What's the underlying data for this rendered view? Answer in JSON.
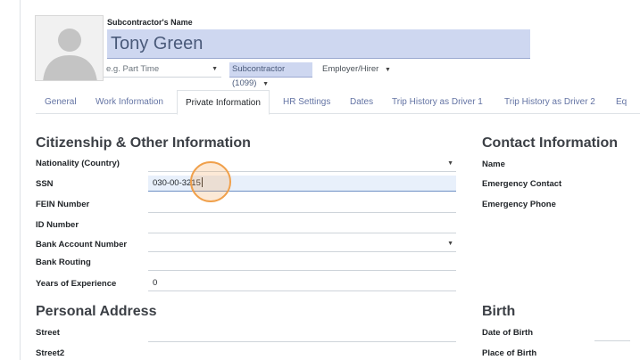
{
  "header": {
    "name_caption": "Subcontractor's Name",
    "name_value": "Tony Green",
    "time_type_placeholder": "e.g. Part Time",
    "subcontractor_type": "Subcontractor (1099)",
    "employer_type": "Employer/Hirer"
  },
  "tabs": [
    {
      "label": "General"
    },
    {
      "label": "Work Information"
    },
    {
      "label": "Private Information",
      "active": true
    },
    {
      "label": "HR Settings"
    },
    {
      "label": "Dates"
    },
    {
      "label": "Trip History as Driver 1"
    },
    {
      "label": "Trip History as Driver 2"
    },
    {
      "label": "Eq"
    }
  ],
  "citizenship": {
    "title": "Citizenship & Other Information",
    "rows": [
      {
        "label": "Nationality (Country)",
        "value": ""
      },
      {
        "label": "SSN",
        "value": "030-00-3215"
      },
      {
        "label": "FEIN Number",
        "value": ""
      },
      {
        "label": "ID Number",
        "value": ""
      },
      {
        "label": "Bank Account Number",
        "value": ""
      },
      {
        "label": "Bank Routing",
        "value": ""
      },
      {
        "label": "Years of Experience",
        "value": "0"
      }
    ]
  },
  "contact": {
    "title": "Contact Information",
    "labels": [
      "Name",
      "Emergency Contact",
      "Emergency Phone"
    ]
  },
  "address": {
    "title": "Personal Address",
    "labels": [
      "Street",
      "Street2"
    ]
  },
  "birth": {
    "title": "Birth",
    "labels": [
      "Date of Birth",
      "Place of Birth"
    ]
  },
  "colors": {
    "accent_field": "#ced7f0",
    "tab_link": "#6474a4",
    "click_highlight": "#f0a04b"
  }
}
